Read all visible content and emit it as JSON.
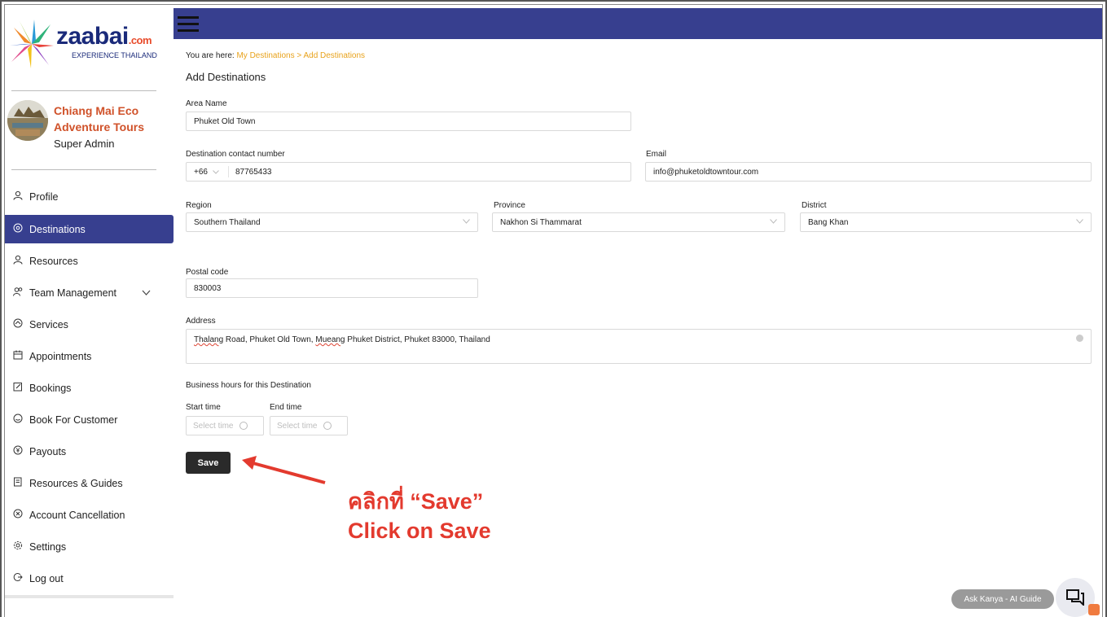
{
  "brand": {
    "logo_text": "zaabai",
    "logo_suffix": ".com",
    "logo_tagline": "EXPERIENCE THAILAND",
    "colors": {
      "sidebar_active": "#373f8f",
      "topbar": "#373f8f",
      "accent": "#e8a21b",
      "annotation": "#e33a2e"
    }
  },
  "user": {
    "org_name": "Chiang Mai Eco Adventure Tours",
    "role": "Super Admin"
  },
  "sidebar": {
    "items": [
      {
        "label": "Profile",
        "icon": "person-icon"
      },
      {
        "label": "Destinations",
        "icon": "location-icon",
        "active": true
      },
      {
        "label": "Resources",
        "icon": "person-icon"
      },
      {
        "label": "Team Management",
        "icon": "team-icon",
        "expandable": true
      },
      {
        "label": "Services",
        "icon": "services-icon"
      },
      {
        "label": "Appointments",
        "icon": "calendar-icon"
      },
      {
        "label": "Bookings",
        "icon": "edit-icon"
      },
      {
        "label": "Book For Customer",
        "icon": "customer-icon"
      },
      {
        "label": "Payouts",
        "icon": "currency-icon"
      },
      {
        "label": "Resources & Guides",
        "icon": "guide-icon"
      },
      {
        "label": "Account Cancellation",
        "icon": "cancel-icon"
      },
      {
        "label": "Settings",
        "icon": "gear-icon"
      },
      {
        "label": "Log out",
        "icon": "logout-icon"
      }
    ]
  },
  "breadcrumb": {
    "prefix": "You are here:",
    "link": "My Destinations",
    "current": "> Add Destinations"
  },
  "page": {
    "title": "Add Destinations"
  },
  "form": {
    "area_name": {
      "label": "Area Name",
      "value": "Phuket Old Town"
    },
    "contact": {
      "label": "Destination contact number",
      "code": "+66",
      "value": "87765433"
    },
    "email": {
      "label": "Email",
      "value": "info@phuketoldtowntour.com"
    },
    "region": {
      "label": "Region",
      "value": "Southern Thailand"
    },
    "province": {
      "label": "Province",
      "value": "Nakhon Si Thammarat"
    },
    "district": {
      "label": "District",
      "value": "Bang Khan"
    },
    "postal": {
      "label": "Postal code",
      "value": "830003"
    },
    "address": {
      "label": "Address",
      "value_a": "Thalang",
      "value_b": " Road, Phuket Old Town, ",
      "value_c": "Mueang",
      "value_d": " Phuket District, Phuket 83000, Thailand"
    },
    "business_hours": {
      "label": "Business hours for this Destination",
      "start_label": "Start time",
      "end_label": "End time",
      "start_placeholder": "Select time",
      "end_placeholder": "Select time"
    },
    "save_label": "Save"
  },
  "annotation": {
    "line1": "คลิกที่ “Save”",
    "line2": "Click on Save"
  },
  "assistant": {
    "label": "Ask Kanya - AI Guide"
  }
}
